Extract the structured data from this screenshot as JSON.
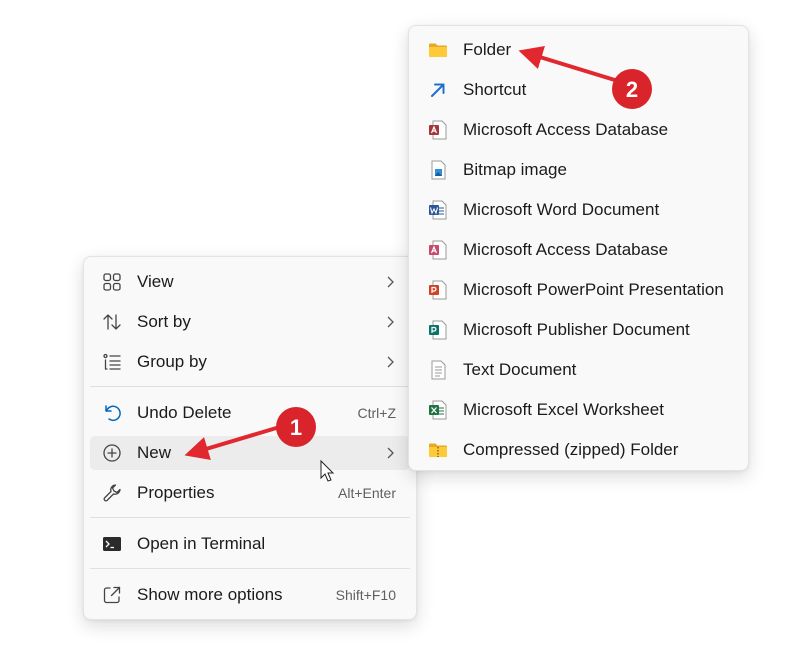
{
  "context_menu": {
    "items": [
      {
        "label": "View",
        "icon": "grid-view-icon"
      },
      {
        "label": "Sort by",
        "icon": "sort-arrows-icon"
      },
      {
        "label": "Group by",
        "icon": "group-list-icon"
      },
      {
        "label": "Undo Delete",
        "shortcut": "Ctrl+Z",
        "icon": "undo-icon"
      },
      {
        "label": "New",
        "icon": "plus-circle-icon"
      },
      {
        "label": "Properties",
        "shortcut": "Alt+Enter",
        "icon": "wrench-icon"
      },
      {
        "label": "Open in Terminal",
        "icon": "terminal-icon"
      },
      {
        "label": "Show more options",
        "shortcut": "Shift+F10",
        "icon": "share-external-icon"
      }
    ]
  },
  "new_submenu": {
    "items": [
      {
        "label": "Folder",
        "icon": "folder-icon"
      },
      {
        "label": "Shortcut",
        "icon": "shortcut-arrow-icon"
      },
      {
        "label": "Microsoft Access Database",
        "icon": "access-icon"
      },
      {
        "label": "Bitmap image",
        "icon": "bitmap-icon"
      },
      {
        "label": "Microsoft Word Document",
        "icon": "word-icon"
      },
      {
        "label": "Microsoft Access Database",
        "icon": "access-icon"
      },
      {
        "label": "Microsoft PowerPoint Presentation",
        "icon": "powerpoint-icon"
      },
      {
        "label": "Microsoft Publisher Document",
        "icon": "publisher-icon"
      },
      {
        "label": "Text Document",
        "icon": "text-document-icon"
      },
      {
        "label": "Microsoft Excel Worksheet",
        "icon": "excel-icon"
      },
      {
        "label": "Compressed (zipped) Folder",
        "icon": "zip-folder-icon"
      }
    ]
  },
  "annotations": {
    "badges": [
      "1",
      "2"
    ],
    "color": "#e0282e"
  },
  "colors": {
    "menu_background": "#f9f9f9",
    "hover_background": "#ececec",
    "accent": "#0067c0"
  }
}
